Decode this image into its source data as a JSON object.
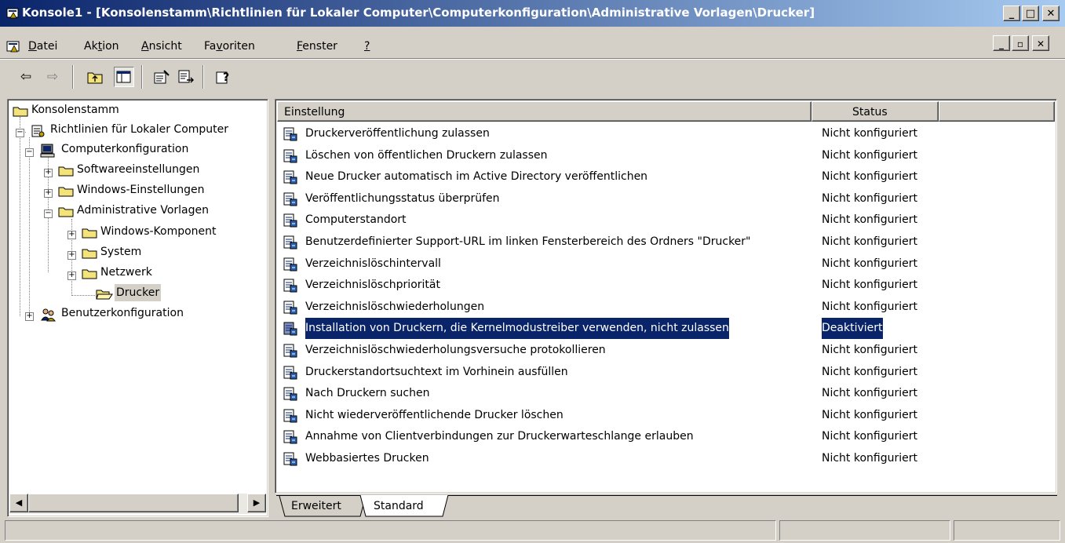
{
  "window": {
    "title": "Konsole1 - [Konsolenstamm\\Richtlinien für Lokaler Computer\\Computerkonfiguration\\Administrative Vorlagen\\Drucker]",
    "icon": "mmc-console-icon",
    "minimize": "_",
    "maximize": "□",
    "close": "✕"
  },
  "menu": {
    "items": [
      {
        "pre": "",
        "u": "D",
        "post": "atei"
      },
      {
        "pre": "Ak",
        "u": "t",
        "post": "ion"
      },
      {
        "pre": "",
        "u": "A",
        "post": "nsicht"
      },
      {
        "pre": "Fa",
        "u": "v",
        "post": "oriten"
      },
      {
        "pre": "",
        "u": "F",
        "post": "enster"
      },
      {
        "pre": "",
        "u": "?",
        "post": ""
      }
    ],
    "mdi_minimize": "_",
    "mdi_restore": "▫",
    "mdi_close": "✕"
  },
  "toolbar": {
    "back": "⇦",
    "forward": "⇨",
    "up": "⬑",
    "show_hide_tree": "▥",
    "properties": "☷",
    "export": "⇲",
    "help": "?"
  },
  "tree": {
    "root": "Konsolenstamm",
    "policy": "Richtlinien für Lokaler Computer",
    "computer_config": "Computerkonfiguration",
    "software": "Softwareeinstellungen",
    "windows": "Windows-Einstellungen",
    "admin": "Administrative Vorlagen",
    "components": "Windows-Komponent",
    "system": "System",
    "network": "Netzwerk",
    "printers": "Drucker",
    "user_config": "Benutzerkonfiguration",
    "expand": "+",
    "collapse": "−"
  },
  "scroll": {
    "left": "◀",
    "right": "▶"
  },
  "list": {
    "col_setting": "Einstellung",
    "col_status": "Status",
    "rows": [
      {
        "name": "Druckerveröffentlichung zulassen",
        "status": "Nicht konfiguriert"
      },
      {
        "name": "Löschen von öffentlichen Druckern zulassen",
        "status": "Nicht konfiguriert"
      },
      {
        "name": "Neue Drucker automatisch im Active Directory veröffentlichen",
        "status": "Nicht konfiguriert"
      },
      {
        "name": "Veröffentlichungsstatus überprüfen",
        "status": "Nicht konfiguriert"
      },
      {
        "name": "Computerstandort",
        "status": "Nicht konfiguriert"
      },
      {
        "name": "Benutzerdefinierter Support-URL im linken Fensterbereich des Ordners \"Drucker\"",
        "status": "Nicht konfiguriert"
      },
      {
        "name": "Verzeichnislöschintervall",
        "status": "Nicht konfiguriert"
      },
      {
        "name": "Verzeichnislöschpriorität",
        "status": "Nicht konfiguriert"
      },
      {
        "name": "Verzeichnislöschwiederholungen",
        "status": "Nicht konfiguriert"
      },
      {
        "name": "Installation von Druckern, die Kernelmodustreiber verwenden, nicht zulassen",
        "status": "Deaktiviert"
      },
      {
        "name": "Verzeichnislöschwiederholungsversuche protokollieren",
        "status": "Nicht konfiguriert"
      },
      {
        "name": "Druckerstandortsuchtext im Vorhinein ausfüllen",
        "status": "Nicht konfiguriert"
      },
      {
        "name": "Nach Druckern suchen",
        "status": "Nicht konfiguriert"
      },
      {
        "name": "Nicht wiederveröffentlichende Drucker löschen",
        "status": "Nicht konfiguriert"
      },
      {
        "name": "Annahme von Clientverbindungen zur Druckerwarteschlange erlauben",
        "status": "Nicht konfiguriert"
      },
      {
        "name": "Webbasiertes Drucken",
        "status": "Nicht konfiguriert"
      }
    ],
    "selected_index": 9
  },
  "tabs": {
    "extended": "Erweitert",
    "standard": "Standard"
  },
  "colors": {
    "title_start": "#0a246a",
    "title_end": "#a6caf0",
    "selection": "#0a246a",
    "face": "#d4d0c8"
  }
}
